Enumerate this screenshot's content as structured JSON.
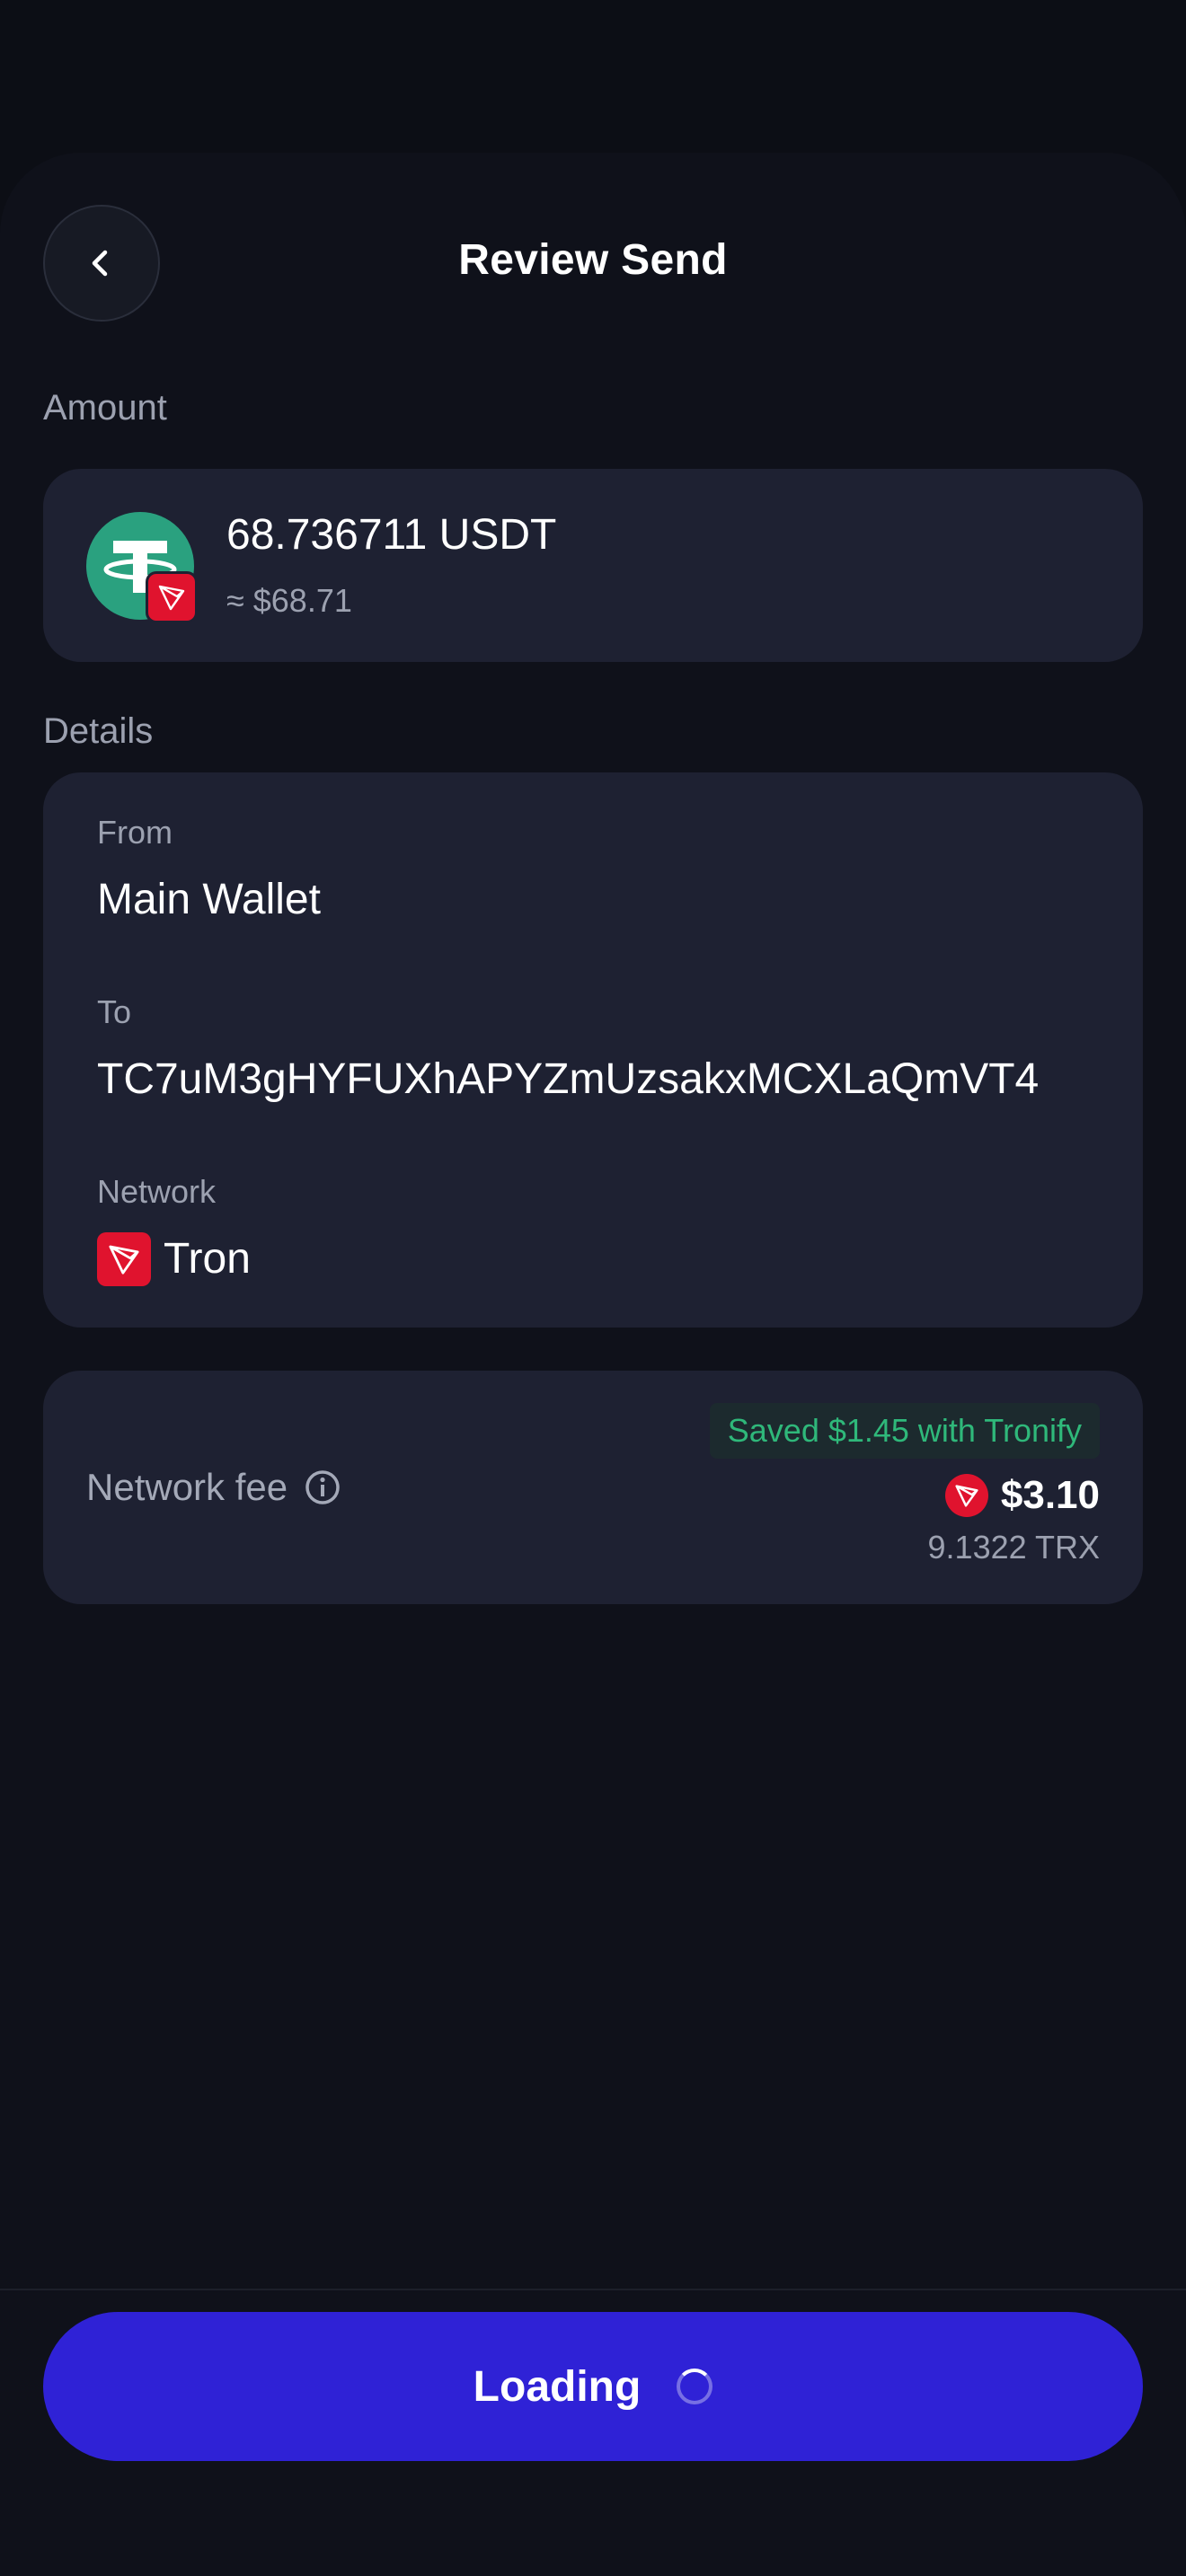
{
  "header": {
    "title": "Review Send",
    "back_icon": "chevron-left-icon"
  },
  "amount_section": {
    "label": "Amount",
    "amount": "68.736711 USDT",
    "fiat": "≈ $68.71",
    "token_icon": "tether-icon",
    "network_badge_icon": "tron-icon"
  },
  "details_section": {
    "label": "Details",
    "from_label": "From",
    "from_value": "Main Wallet",
    "to_label": "To",
    "to_value": "TC7uM3gHYFUXhAPYZmUzsakxMCXLaQmVT4",
    "network_label": "Network",
    "network_value": "Tron",
    "network_icon": "tron-icon"
  },
  "fee_section": {
    "label": "Network fee",
    "info_icon": "info-icon",
    "saved_badge": "Saved $1.45 with Tronify",
    "fee_usd": "$3.10",
    "fee_trx": "9.1322 TRX"
  },
  "footer": {
    "button_label": "Loading",
    "button_state": "loading"
  },
  "colors": {
    "background": "#0f111a",
    "card": "#1e2132",
    "accent": "#2f22d6",
    "tron": "#e0132e",
    "tether": "#2aa17f",
    "success": "#2fb87a"
  }
}
